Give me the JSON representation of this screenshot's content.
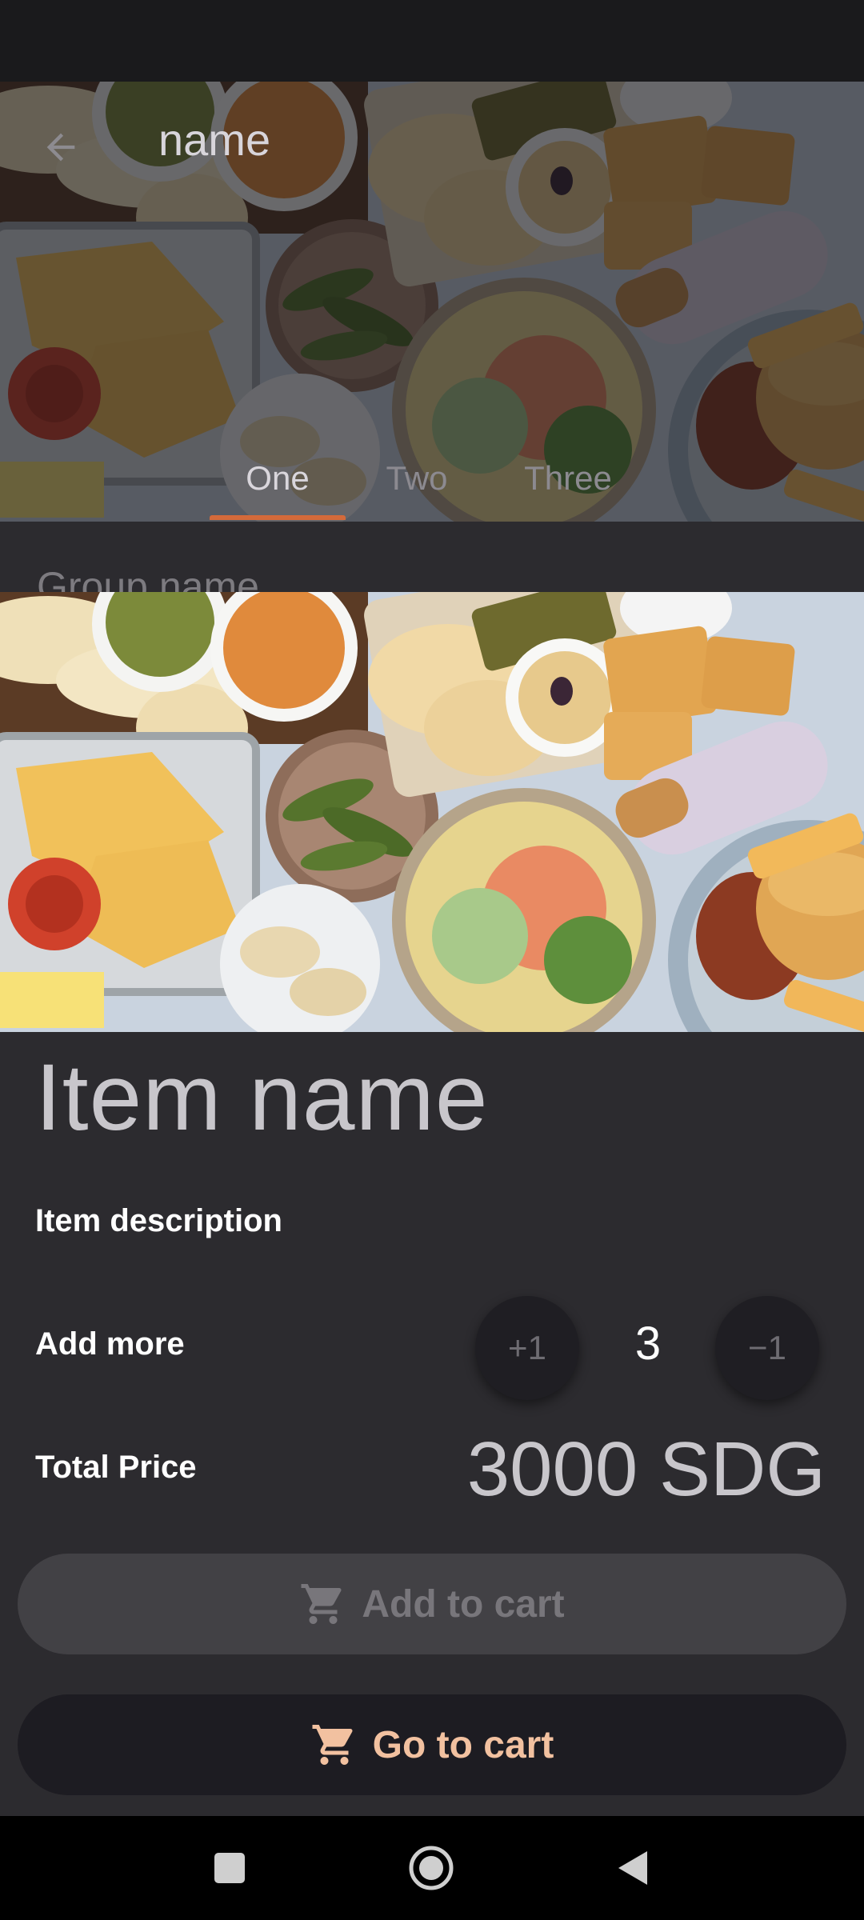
{
  "header": {
    "title": "name",
    "back_icon": "arrow-left-icon"
  },
  "tabs": [
    {
      "label": "One",
      "active": true
    },
    {
      "label": "Two",
      "active": false
    },
    {
      "label": "Three",
      "active": false
    }
  ],
  "group": {
    "name": "Group name"
  },
  "item": {
    "name": "Item name",
    "description": "Item description",
    "add_more_label": "Add more",
    "plus_label": "+1",
    "minus_label": "−1",
    "quantity": "3",
    "total_label": "Total Price",
    "total_price": "3000 SDG"
  },
  "actions": {
    "add_to_cart": "Add to cart",
    "go_to_cart": "Go to cart",
    "cart_icon": "shopping-cart-icon"
  },
  "navigation": {
    "recents_icon": "square-icon",
    "home_icon": "circle-home-icon",
    "back_icon": "triangle-back-icon"
  },
  "colors": {
    "accent": "#d46a3a",
    "go_to_cart_text": "#f2c1a0",
    "background": "#2c2b2f"
  }
}
